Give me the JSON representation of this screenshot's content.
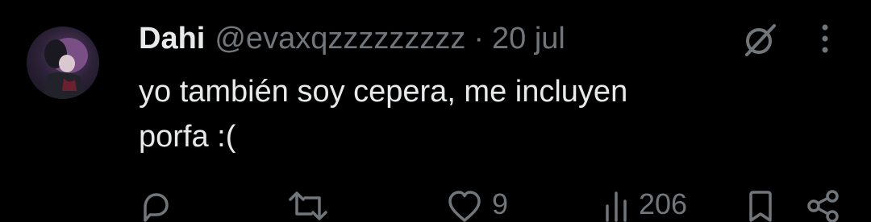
{
  "tweet": {
    "author": {
      "display_name": "Dahi",
      "handle": "@evaxqzzzzzzzzz",
      "avatar": "anime-character-avatar"
    },
    "separator": "·",
    "date": "20 jul",
    "text": "yo también soy cepera, me incluyen\nporfa :("
  },
  "header_icons": [
    "grok-icon",
    "more-options-icon"
  ],
  "actions": {
    "reply": {
      "icon": "reply-icon",
      "count": ""
    },
    "retweet": {
      "icon": "retweet-icon",
      "count": ""
    },
    "like": {
      "icon": "heart-icon",
      "count": "9"
    },
    "views": {
      "icon": "views-chart-icon",
      "count": "206"
    },
    "bookmark": {
      "icon": "bookmark-icon",
      "count": ""
    },
    "share": {
      "icon": "share-icon",
      "count": ""
    }
  },
  "colors": {
    "background": "#000000",
    "primary_text": "#e7e9ea",
    "secondary_text": "#71767b"
  }
}
